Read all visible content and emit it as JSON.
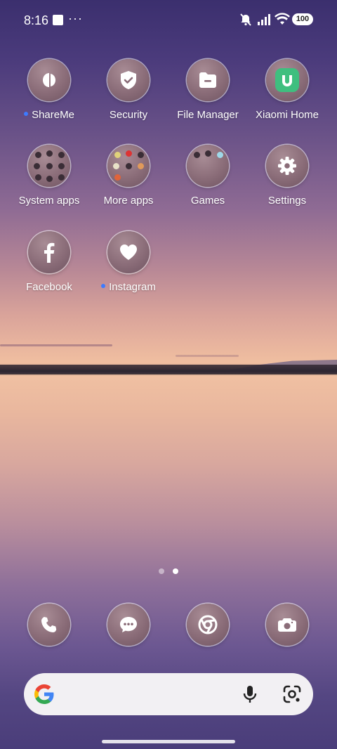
{
  "status_bar": {
    "time": "8:16",
    "more": "···",
    "battery": "100"
  },
  "apps": [
    {
      "label": "ShareMe",
      "icon": "shareme-icon",
      "new": true
    },
    {
      "label": "Security",
      "icon": "shield-check-icon",
      "new": false
    },
    {
      "label": "File Manager",
      "icon": "folder-icon",
      "new": false
    },
    {
      "label": "Xiaomi Home",
      "icon": "mi-home-icon",
      "new": false
    },
    {
      "label": "System apps",
      "icon": "folder-grid-icon",
      "new": false
    },
    {
      "label": "More apps",
      "icon": "folder-grid-icon",
      "new": false
    },
    {
      "label": "Games",
      "icon": "folder-grid-icon",
      "new": false
    },
    {
      "label": "Settings",
      "icon": "gear-icon",
      "new": false
    },
    {
      "label": "Facebook",
      "icon": "facebook-icon",
      "new": false
    },
    {
      "label": "Instagram",
      "icon": "heart-icon",
      "new": true
    }
  ],
  "pager": {
    "pages": 2,
    "current": 2
  },
  "dock": [
    {
      "icon": "phone-icon"
    },
    {
      "icon": "message-icon"
    },
    {
      "icon": "chrome-icon"
    },
    {
      "icon": "camera-icon"
    }
  ],
  "search_bar": {
    "logo": "google-g-icon",
    "mic": "mic-icon",
    "lens": "lens-icon"
  },
  "colors": {
    "accent_dot": "#3d7bff",
    "mi_home_green": "#3fbf7f"
  }
}
